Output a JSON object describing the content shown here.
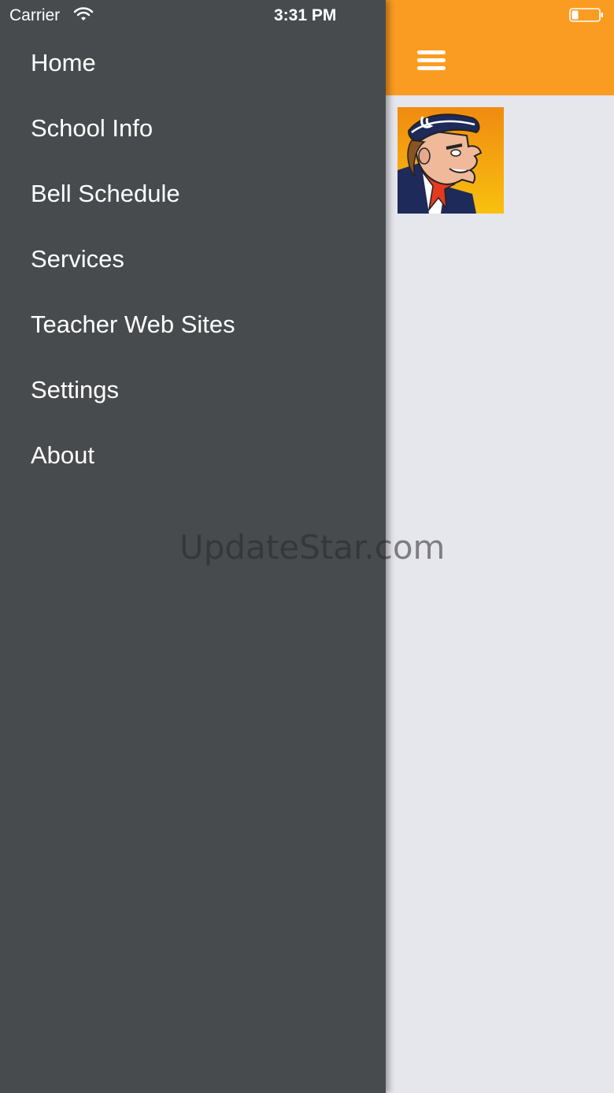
{
  "status_bar": {
    "carrier": "Carrier",
    "time": "3:31 PM",
    "wifi_icon": "wifi-icon",
    "battery_icon": "battery-low-icon"
  },
  "menu": {
    "items": [
      {
        "label": "Home"
      },
      {
        "label": "School Info"
      },
      {
        "label": "Bell Schedule"
      },
      {
        "label": "Services"
      },
      {
        "label": "Teacher Web Sites"
      },
      {
        "label": "Settings"
      },
      {
        "label": "About"
      }
    ]
  },
  "header": {
    "menu_icon": "hamburger-menu-icon",
    "accent_color": "#fb9c22"
  },
  "drawer": {
    "background_color": "#484b4d"
  },
  "watermark": "UpdateStar.com"
}
